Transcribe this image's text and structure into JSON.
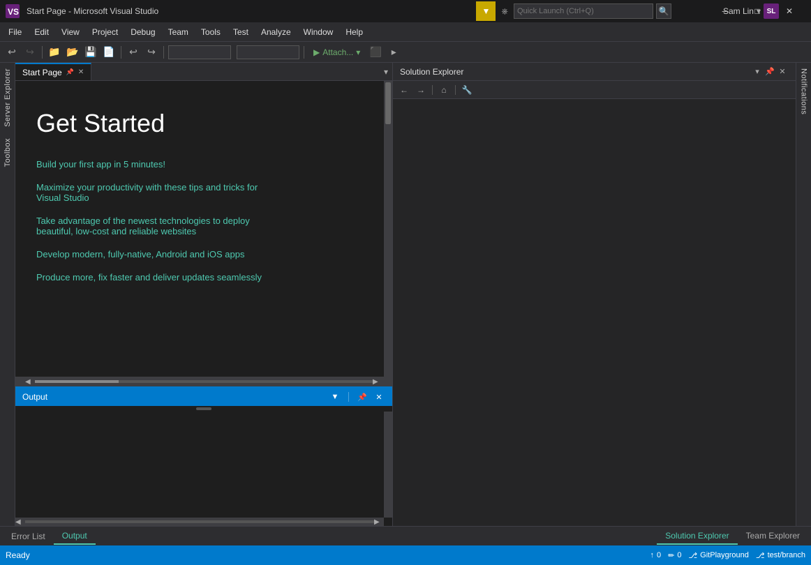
{
  "titleBar": {
    "title": "Start Page - Microsoft Visual Studio",
    "minimize": "─",
    "restore": "□",
    "close": "✕",
    "logo": "VS"
  },
  "quickLaunch": {
    "placeholder": "Quick Launch (Ctrl+Q)",
    "filterIcon": "▼",
    "searchIcon": "🔍"
  },
  "menuBar": {
    "items": [
      "File",
      "Edit",
      "View",
      "Project",
      "Debug",
      "Team",
      "Tools",
      "Test",
      "Analyze",
      "Window",
      "Help"
    ]
  },
  "toolbar": {
    "attachLabel": "Attach...",
    "attachDropdown": "▾"
  },
  "tabs": {
    "startPage": {
      "label": "Start Page",
      "pinIcon": "📌",
      "closeIcon": "✕"
    },
    "dropdownIcon": "▼"
  },
  "startPage": {
    "title": "Get Started",
    "links": [
      {
        "id": "link1",
        "text": "Build your first app in 5 minutes!"
      },
      {
        "id": "link2",
        "line1": "Maximize your productivity with these tips and tricks for",
        "line2": "Visual Studio"
      },
      {
        "id": "link3",
        "line1": "Take advantage of the newest technologies to deploy",
        "line2": "beautiful, low-cost and reliable websites"
      },
      {
        "id": "link4",
        "text": "Develop modern, fully-native, Android and iOS apps"
      },
      {
        "id": "link5",
        "text": "Produce more, fix faster and deliver updates seamlessly"
      }
    ]
  },
  "leftSidebar": {
    "serverExplorer": "Server Explorer",
    "toolbox": "Toolbox"
  },
  "solutionExplorer": {
    "title": "Solution Explorer",
    "pinIcon": "📌",
    "closeIcon": "✕",
    "dropdownIcon": "▼",
    "toolbar": {
      "backIcon": "←",
      "forwardIcon": "→",
      "homeIcon": "⌂",
      "wrenchIcon": "🔧"
    }
  },
  "notifications": {
    "label": "Notifications"
  },
  "outputPanel": {
    "title": "Output",
    "dropdownIcon": "▼",
    "pinIcon": "📌",
    "closeIcon": "✕"
  },
  "bottomTabs": {
    "errorList": "Error List",
    "output": "Output"
  },
  "statusBar": {
    "ready": "Ready",
    "gitPlayground": "GitPlayground",
    "branch": "test/branch",
    "errors": "0",
    "warnings": "0",
    "upArrow": "↑",
    "downArrow": "↓",
    "pencilIcon": "✏",
    "gitIcon": "⎇",
    "branchIcon": "⎇"
  },
  "userArea": {
    "name": "Sam Lin",
    "initials": "SL",
    "dropdownIcon": "▾"
  },
  "colors": {
    "accent": "#007acc",
    "linkColor": "#4ec9b0",
    "titleColor": "#ffffff",
    "background": "#1e1e1e",
    "panelBg": "#2d2d30",
    "statusBar": "#007acc"
  }
}
